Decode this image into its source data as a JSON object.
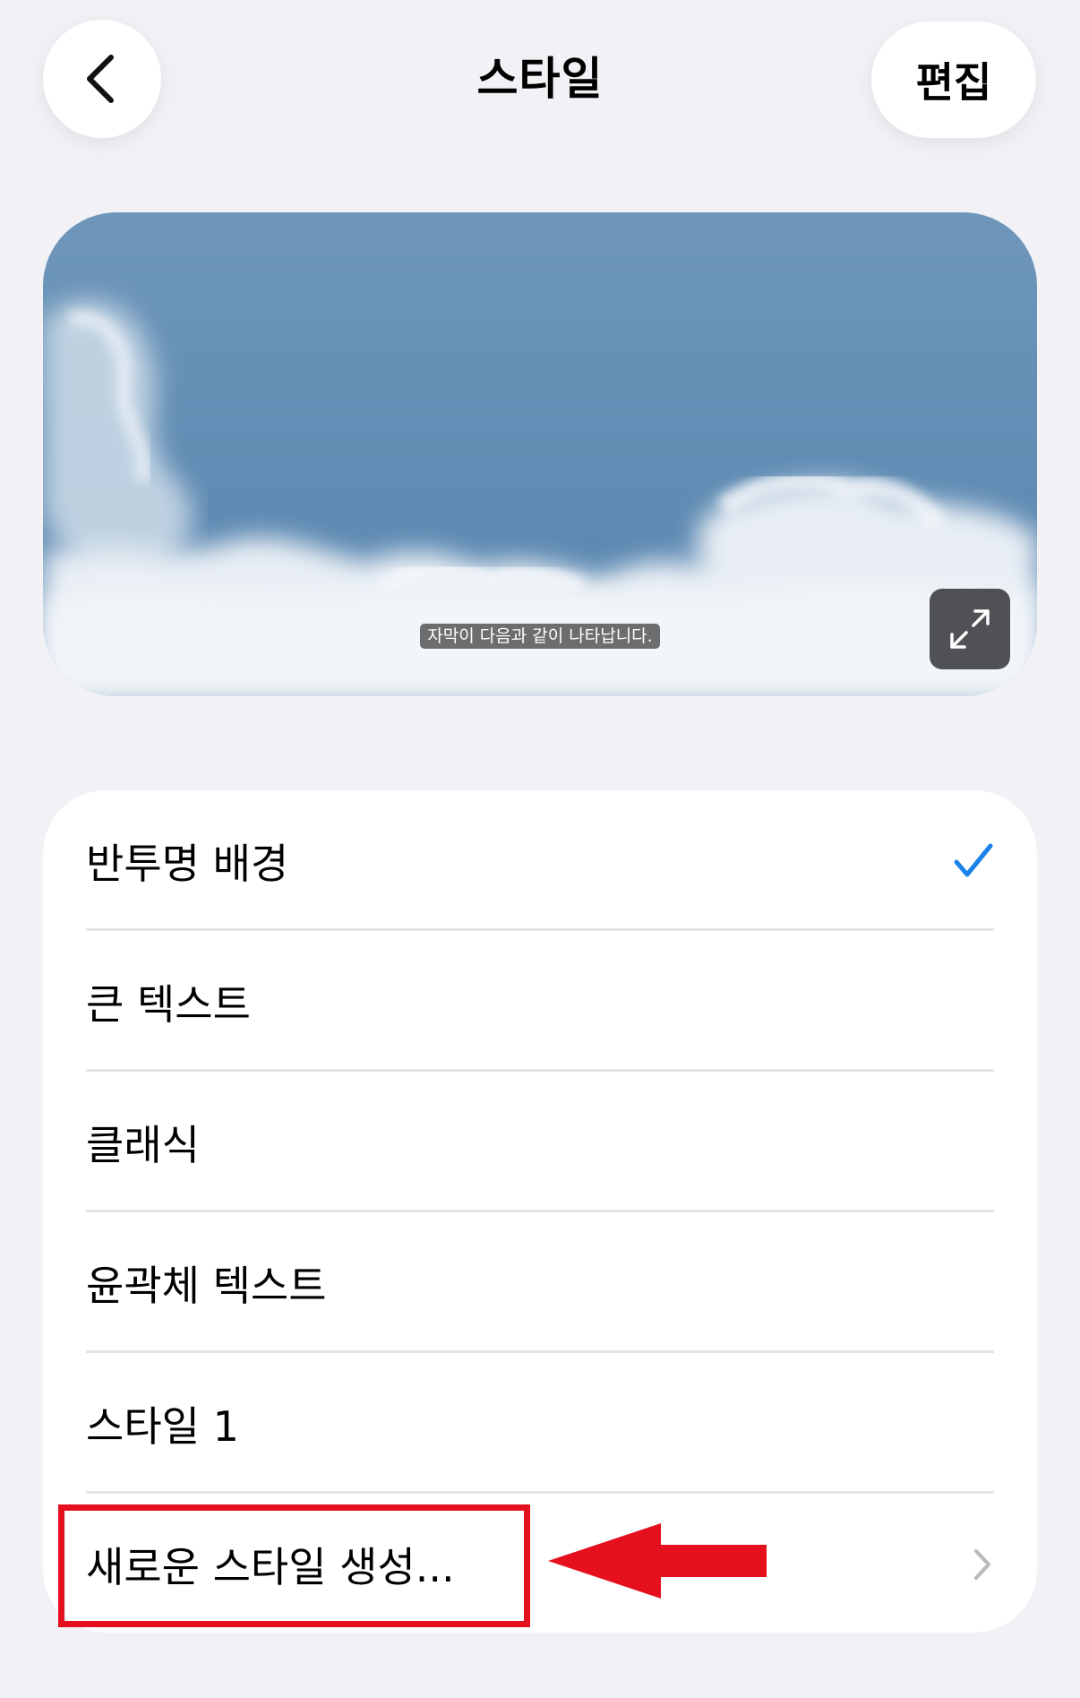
{
  "nav": {
    "title": "스타일",
    "edit_label": "편집",
    "back_icon": "chevron-left-icon"
  },
  "preview": {
    "caption": "자막이 다음과 같이 나타납니다.",
    "expand_icon": "expand-arrows-icon"
  },
  "styles": {
    "items": [
      {
        "label": "반투명 배경",
        "selected": true
      },
      {
        "label": "큰 텍스트",
        "selected": false
      },
      {
        "label": "클래식",
        "selected": false
      },
      {
        "label": "윤곽체 텍스트",
        "selected": false
      },
      {
        "label": "스타일 1",
        "selected": false
      }
    ],
    "create_label": "새로운 스타일 생성..."
  },
  "colors": {
    "background": "#f1f1f6",
    "accent": "#1a82e8",
    "annotation": "#e5101d"
  }
}
